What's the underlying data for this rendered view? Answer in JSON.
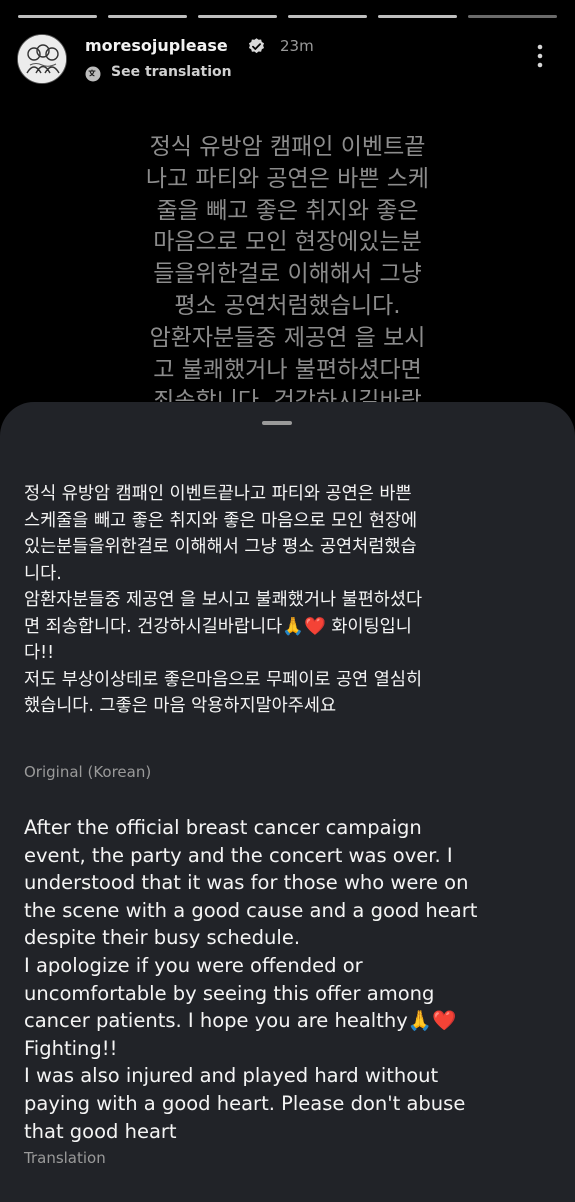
{
  "story": {
    "segments": 6,
    "author": {
      "username": "moresojuplease",
      "time": "23m",
      "avatar_icon": "avatar-illustration-icon",
      "verified_icon": "verified-badge-icon"
    },
    "see_translation_label": "See translation",
    "more_icon": "more-vertical-icon",
    "image_text": "정식 유방암 캠패인 이벤트끝\n나고 파티와 공연은 바쁜 스케\n줄을 빼고 좋은 취지와 좋은\n마음으로 모인 현장에있는분\n들을위한걸로 이해해서 그냥\n평소 공연처럼했습니다.\n암환자분들중 제공연 을 보시\n고 불쾌했거나 불편하셨다면\n죄송합니다. 건강하시길바람"
  },
  "sheet": {
    "original_text": "정식 유방암 캠패인  이벤트끝나고 파티와 공연은 바쁜\n스케줄을 빼고 좋은 취지와 좋은 마음으로 모인 현장에\n있는분들을위한걸로 이해해서 그냥 평소 공연처럼했습\n니다.\n 암환자분들중 제공연 을 보시고 불쾌했거나 불편하셨다\n면 죄송합니다. 건강하시길바랍니다🙏❤️ 화이팅입니\n다!!\n저도 부상이상테로 좋은마음으로 무페이로 공연 열심히\n했습니다.  그좋은 마음 악용하지말아주세요",
    "original_label": "Original (Korean)",
    "translation_text": "After the official breast cancer campaign\nevent, the party and the concert was over. I\nunderstood that it was for those who were on\nthe scene with a good cause and a good heart\ndespite their busy schedule.\nI apologize if you were offended or\nuncomfortable by seeing this offer among\ncancer patients. I hope you are healthy🙏❤️\nFighting!!\nI was also injured and played hard without\npaying with a good heart. Please don't abuse\nthat good heart",
    "translation_label": "Translation"
  }
}
